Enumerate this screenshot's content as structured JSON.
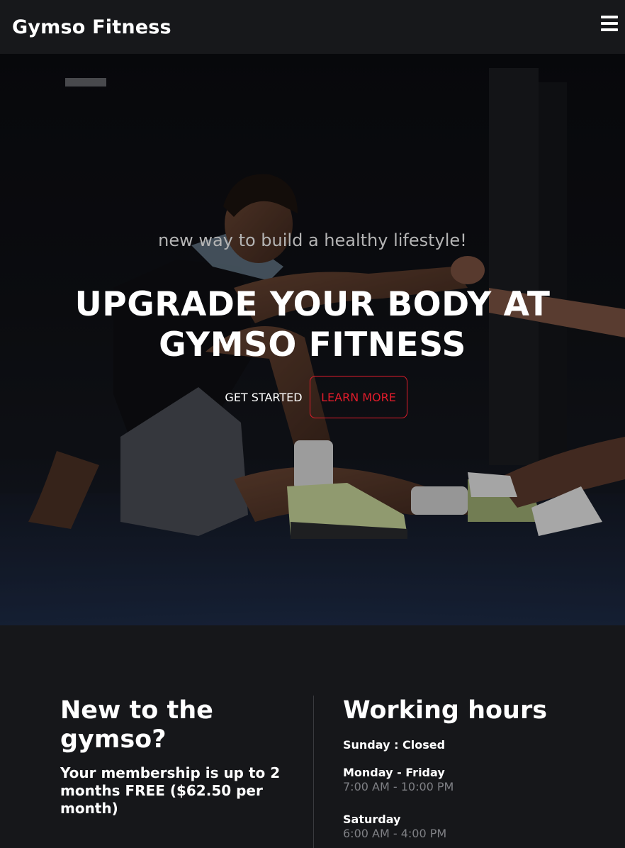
{
  "navbar": {
    "brand": "Gymso Fitness",
    "menu_icon": "hamburger-menu-icon"
  },
  "hero": {
    "tagline": "new way to build a healthy lifestyle!",
    "title": "UPGRADE YOUR BODY AT GYMSO FITNESS",
    "primary_button": "GET STARTED",
    "secondary_button": "LEARN MORE"
  },
  "info": {
    "new_title": "New to the gymso?",
    "membership_text": "Your membership is up to 2 months FREE ($62.50 per month)",
    "hours_title": "Working hours",
    "closed_day": "Sunday : Closed",
    "hours": [
      {
        "day": "Monday - Friday",
        "time": "7:00 AM - 10:00 PM"
      },
      {
        "day": "Saturday",
        "time": "6:00 AM - 4:00 PM"
      }
    ]
  },
  "colors": {
    "accent": "#e21c2b",
    "background": "#16171a",
    "muted_text": "#7f8085"
  }
}
